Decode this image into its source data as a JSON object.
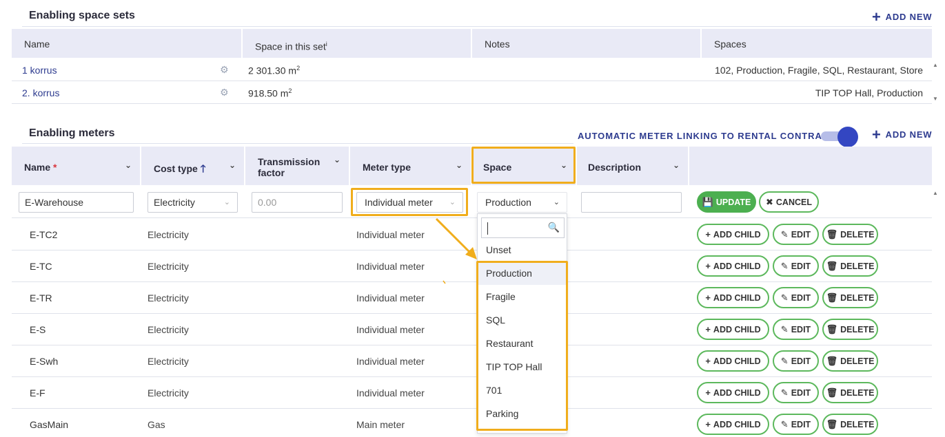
{
  "space_sets": {
    "title": "Enabling space sets",
    "add_new": "ADD NEW",
    "columns": [
      "Name",
      "Space in this set",
      "Notes",
      "Spaces"
    ],
    "column_info": "i",
    "rows": [
      {
        "name": "1 korrus",
        "area": "2 301.30 m",
        "spaces": "102, Production, Fragile, SQL, Restaurant, Store"
      },
      {
        "name": "2. korrus",
        "area": "918.50 m",
        "spaces": "TIP TOP Hall, Production"
      }
    ],
    "area_unit_sup": "2"
  },
  "meters": {
    "title": "Enabling meters",
    "auto_link_label": "AUTOMATIC METER LINKING TO RENTAL CONTRACTS",
    "auto_link_enabled": true,
    "add_new": "ADD NEW",
    "columns": {
      "name": "Name",
      "required_mark": "*",
      "cost_type": "Cost type",
      "transmission_line1": "Transmission",
      "transmission_line2": "factor",
      "meter_type": "Meter type",
      "space": "Space",
      "description": "Description"
    },
    "edit_row": {
      "name": "E-Warehouse",
      "cost_type": "Electricity",
      "transmission_placeholder": "0.00",
      "meter_type": "Individual meter",
      "space": "Production",
      "description": "",
      "update": "UPDATE",
      "cancel": "CANCEL"
    },
    "row_actions": {
      "add_child": "ADD CHILD",
      "edit": "EDIT",
      "delete": "DELETE"
    },
    "rows": [
      {
        "name": "E-TC2",
        "cost_type": "Electricity",
        "meter_type": "Individual meter"
      },
      {
        "name": "E-TC",
        "cost_type": "Electricity",
        "meter_type": "Individual meter"
      },
      {
        "name": "E-TR",
        "cost_type": "Electricity",
        "meter_type": "Individual meter"
      },
      {
        "name": "E-S",
        "cost_type": "Electricity",
        "meter_type": "Individual meter"
      },
      {
        "name": "E-Swh",
        "cost_type": "Electricity",
        "meter_type": "Individual meter"
      },
      {
        "name": "E-F",
        "cost_type": "Electricity",
        "meter_type": "Individual meter"
      },
      {
        "name": "GasMain",
        "cost_type": "Gas",
        "meter_type": "Main meter"
      }
    ]
  },
  "space_dropdown": {
    "search_value": "",
    "options": [
      "Unset",
      "Production",
      "Fragile",
      "SQL",
      "Restaurant",
      "TIP TOP Hall",
      "701",
      "Parking"
    ],
    "selected": "Production"
  },
  "colors": {
    "accent": "#2d3b8f",
    "header_bg": "#e9eaf6",
    "highlight": "#f0ad1c",
    "success": "#4caf50"
  }
}
